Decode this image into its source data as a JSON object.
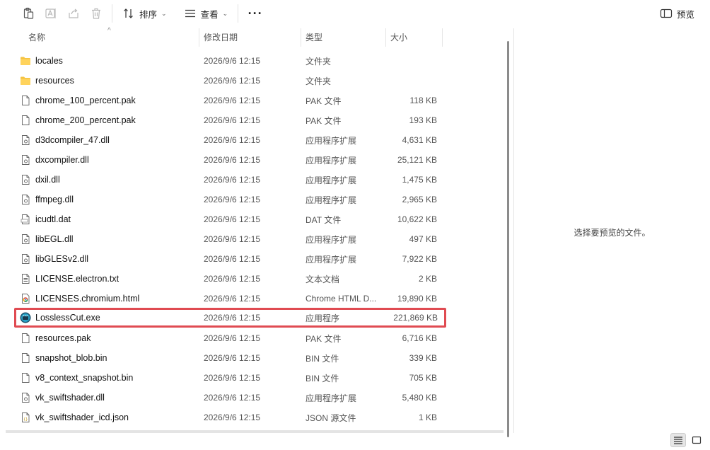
{
  "toolbar": {
    "sort_label": "排序",
    "view_label": "查看",
    "more_label": "···",
    "preview_label": "预览"
  },
  "columns": {
    "name": "名称",
    "date": "修改日期",
    "type": "类型",
    "size": "大小"
  },
  "files": [
    {
      "name": "locales",
      "date": "2026/9/6 12:15",
      "type": "文件夹",
      "size": "",
      "icon": "folder-icon"
    },
    {
      "name": "resources",
      "date": "2026/9/6 12:15",
      "type": "文件夹",
      "size": "",
      "icon": "folder-icon"
    },
    {
      "name": "chrome_100_percent.pak",
      "date": "2026/9/6 12:15",
      "type": "PAK 文件",
      "size": "118 KB",
      "icon": "file-icon"
    },
    {
      "name": "chrome_200_percent.pak",
      "date": "2026/9/6 12:15",
      "type": "PAK 文件",
      "size": "193 KB",
      "icon": "file-icon"
    },
    {
      "name": "d3dcompiler_47.dll",
      "date": "2026/9/6 12:15",
      "type": "应用程序扩展",
      "size": "4,631 KB",
      "icon": "dll-icon"
    },
    {
      "name": "dxcompiler.dll",
      "date": "2026/9/6 12:15",
      "type": "应用程序扩展",
      "size": "25,121 KB",
      "icon": "dll-icon"
    },
    {
      "name": "dxil.dll",
      "date": "2026/9/6 12:15",
      "type": "应用程序扩展",
      "size": "1,475 KB",
      "icon": "dll-icon"
    },
    {
      "name": "ffmpeg.dll",
      "date": "2026/9/6 12:15",
      "type": "应用程序扩展",
      "size": "2,965 KB",
      "icon": "dll-icon"
    },
    {
      "name": "icudtl.dat",
      "date": "2026/9/6 12:15",
      "type": "DAT 文件",
      "size": "10,622 KB",
      "icon": "dat-icon"
    },
    {
      "name": "libEGL.dll",
      "date": "2026/9/6 12:15",
      "type": "应用程序扩展",
      "size": "497 KB",
      "icon": "dll-icon"
    },
    {
      "name": "libGLESv2.dll",
      "date": "2026/9/6 12:15",
      "type": "应用程序扩展",
      "size": "7,922 KB",
      "icon": "dll-icon"
    },
    {
      "name": "LICENSE.electron.txt",
      "date": "2026/9/6 12:15",
      "type": "文本文档",
      "size": "2 KB",
      "icon": "text-file-icon"
    },
    {
      "name": "LICENSES.chromium.html",
      "date": "2026/9/6 12:15",
      "type": "Chrome HTML D...",
      "size": "19,890 KB",
      "icon": "chrome-html-icon"
    },
    {
      "name": "LosslessCut.exe",
      "date": "2026/9/6 12:15",
      "type": "应用程序",
      "size": "221,869 KB",
      "icon": "app-icon",
      "highlight": true
    },
    {
      "name": "resources.pak",
      "date": "2026/9/6 12:15",
      "type": "PAK 文件",
      "size": "6,716 KB",
      "icon": "file-icon"
    },
    {
      "name": "snapshot_blob.bin",
      "date": "2026/9/6 12:15",
      "type": "BIN 文件",
      "size": "339 KB",
      "icon": "file-icon"
    },
    {
      "name": "v8_context_snapshot.bin",
      "date": "2026/9/6 12:15",
      "type": "BIN 文件",
      "size": "705 KB",
      "icon": "file-icon"
    },
    {
      "name": "vk_swiftshader.dll",
      "date": "2026/9/6 12:15",
      "type": "应用程序扩展",
      "size": "5,480 KB",
      "icon": "dll-icon"
    },
    {
      "name": "vk_swiftshader_icd.json",
      "date": "2026/9/6 12:15",
      "type": "JSON 源文件",
      "size": "1 KB",
      "icon": "json-icon"
    }
  ],
  "preview": {
    "message": "选择要预览的文件。"
  },
  "colors": {
    "highlight_border": "#e04b52",
    "folder": "#f5c342",
    "accent": "#0067c0"
  }
}
